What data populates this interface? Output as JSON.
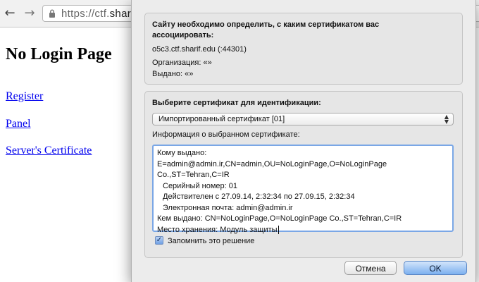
{
  "browser": {
    "url_prefix": "https://ctf.",
    "url_host_visible": "sharif.",
    "back_glyph": "←",
    "forward_glyph": "→"
  },
  "page": {
    "title": "No Login Page",
    "links": [
      "Register",
      "Panel",
      "Server's Certificate"
    ]
  },
  "dialog": {
    "request": {
      "heading_line1": "Сайту необходимо определить, с каким сертификатом вас",
      "heading_line2": "ассоциировать:",
      "host": "o5c3.ctf.sharif.edu (:44301)",
      "organization": "Организация: «»",
      "issued_by": "Выдано: «»"
    },
    "select_label": "Выберите сертификат для идентификации:",
    "selected_certificate": "Импортированный сертификат [01]",
    "details_label": "Информация о выбранном сертификате:",
    "details_lines": [
      "Кому выдано:",
      "E=admin@admin.ir,CN=admin,OU=NoLoginPage,O=NoLoginPage",
      "Co.,ST=Tehran,C=IR",
      "Серийный номер: 01",
      "Действителен с 27.09.14, 2:32:34 по 27.09.15, 2:32:34",
      "Электронная почта: admin@admin.ir",
      "Кем выдано: CN=NoLoginPage,O=NoLoginPage Co.,ST=Tehran,C=IR",
      "Место хранения: Модуль защиты"
    ],
    "remember_label": "Запомнить это решение",
    "remember_checked": true,
    "cancel_label": "Отмена",
    "ok_label": "OK"
  },
  "colors": {
    "link": "#0000ee",
    "focus_ring": "#7aa7e6",
    "ok_button": "#7cb0ef"
  }
}
